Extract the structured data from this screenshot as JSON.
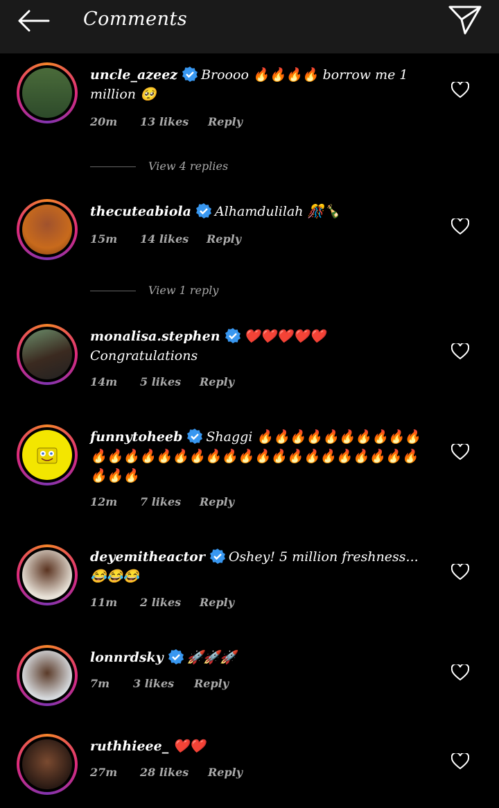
{
  "header": {
    "title": "Comments",
    "back_icon": "back-arrow-icon",
    "send_icon": "send-icon"
  },
  "comments": [
    {
      "user": "uncle_azeez",
      "text": "Broooo 🔥🔥🔥🔥 borrow me 1 million 🥺",
      "time": "20m",
      "likes": "13 likes",
      "reply": "Reply",
      "view": "View 4 replies"
    },
    {
      "user": "thecuteabiola",
      "text": "Alhamdulilah 🎊🍾",
      "time": "15m",
      "likes": "14 likes",
      "reply": "Reply",
      "view": "View 1 reply"
    },
    {
      "user": "monalisa.stephen",
      "text": "❤️❤️❤️❤️❤️ Congratulations",
      "time": "14m",
      "likes": "5 likes",
      "reply": "Reply"
    },
    {
      "user": "funnytoheeb",
      "text": "Shaggi 🔥🔥🔥🔥🔥🔥🔥🔥🔥🔥🔥🔥🔥🔥🔥🔥🔥🔥🔥🔥🔥🔥🔥🔥🔥🔥🔥🔥🔥🔥🔥🔥🔥",
      "time": "12m",
      "likes": "7 likes",
      "reply": "Reply"
    },
    {
      "user": "deyemitheactor",
      "text": "Oshey! 5 million freshness... 😂😂😂",
      "time": "11m",
      "likes": "2 likes",
      "reply": "Reply"
    },
    {
      "user": "lonnrdsky",
      "text": "🚀🚀🚀",
      "time": "7m",
      "likes": "3 likes",
      "reply": "Reply"
    },
    {
      "user": "ruthhieee_",
      "text": "❤️❤️",
      "time": "27m",
      "likes": "28 likes",
      "reply": "Reply"
    }
  ],
  "colors": {
    "verified": "#3897f0",
    "ring_start": "#f58529",
    "ring_end": "#dd2a7b"
  }
}
